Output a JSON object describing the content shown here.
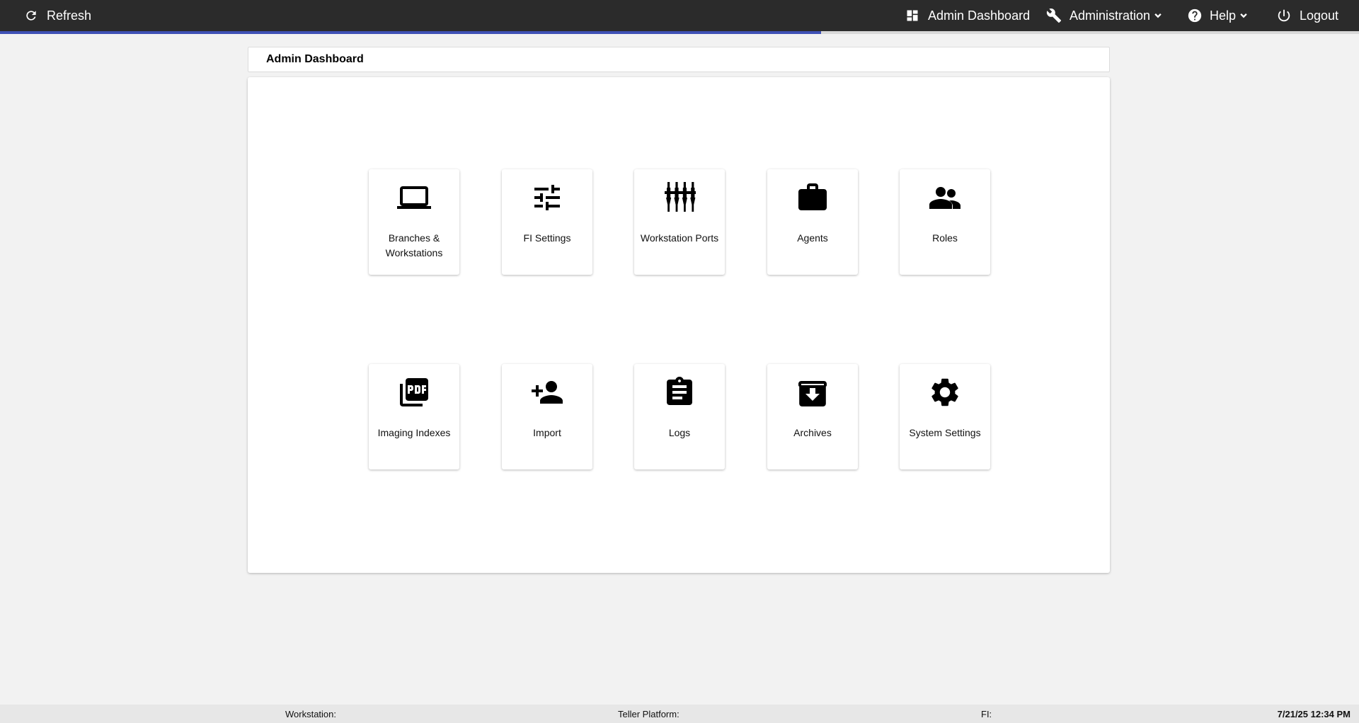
{
  "topbar": {
    "refresh_label": "Refresh",
    "admin_dashboard_label": "Admin Dashboard",
    "administration_label": "Administration",
    "help_label": "Help",
    "logout_label": "Logout"
  },
  "progress": {
    "percent": 60.4
  },
  "page": {
    "title": "Admin Dashboard"
  },
  "tiles": [
    {
      "label": "Branches & Workstations",
      "icon": "laptop-icon"
    },
    {
      "label": "FI Settings",
      "icon": "tune-icon"
    },
    {
      "label": "Workstation Ports",
      "icon": "ports-icon"
    },
    {
      "label": "Agents",
      "icon": "briefcase-icon"
    },
    {
      "label": "Roles",
      "icon": "people-icon"
    },
    {
      "label": "Imaging Indexes",
      "icon": "pdf-icon"
    },
    {
      "label": "Import",
      "icon": "person-add-icon"
    },
    {
      "label": "Logs",
      "icon": "clipboard-icon"
    },
    {
      "label": "Archives",
      "icon": "archive-icon"
    },
    {
      "label": "System Settings",
      "icon": "gear-icon"
    }
  ],
  "footer": {
    "workstation_label": "Workstation:",
    "teller_platform_label": "Teller Platform:",
    "fi_label": "FI:",
    "datetime": "7/21/25 12:34 PM"
  },
  "colors": {
    "topbar_bg": "#2b2b2b",
    "progress_fill": "#3f51b5",
    "page_bg": "#f2f2f2"
  }
}
